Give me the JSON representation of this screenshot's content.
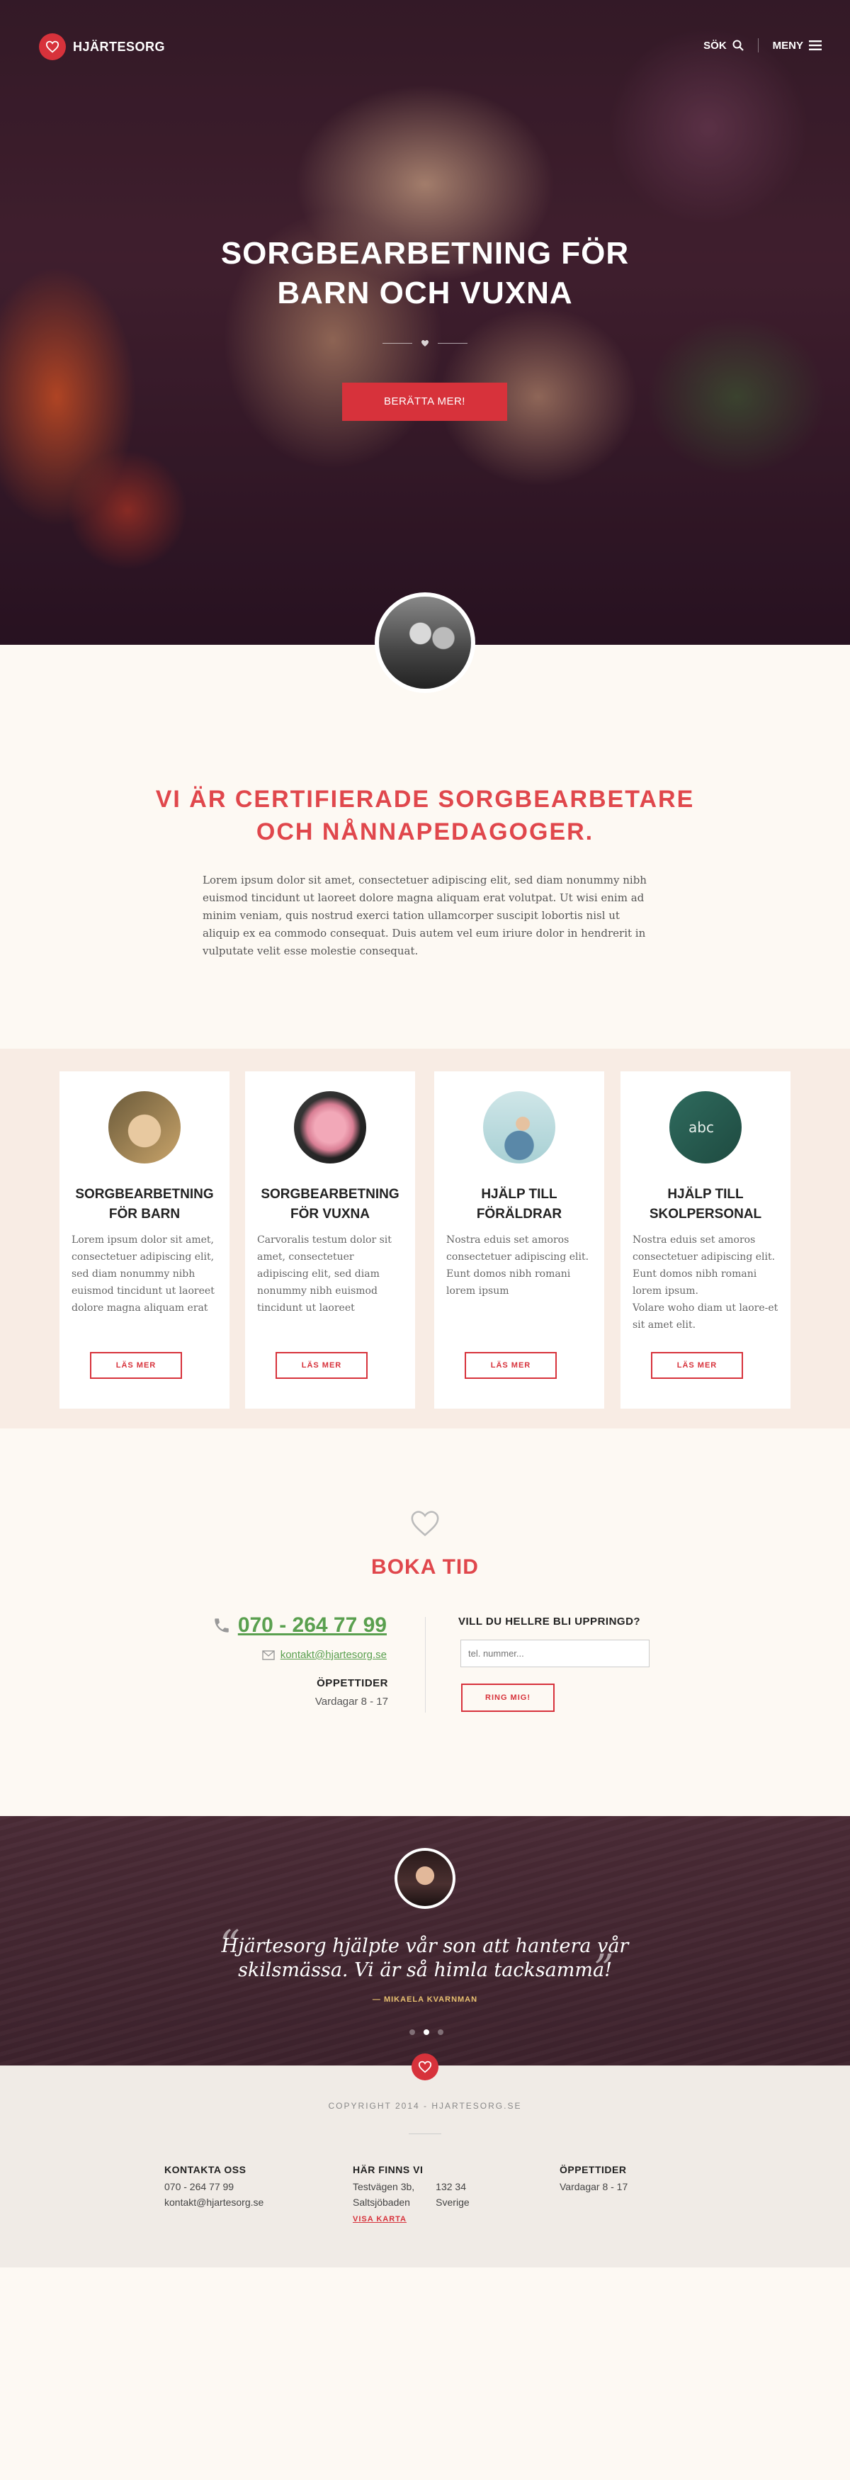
{
  "header": {
    "logo_text": "HJÄRTESORG",
    "search_label": "SÖK",
    "menu_label": "MENY"
  },
  "hero": {
    "title_line1": "SORGBEARBETNING FÖR",
    "title_line2": "BARN OCH VUXNA",
    "cta_label": "BERÄTTA MER!"
  },
  "intro": {
    "title_line1": "VI ÄR CERTIFIERADE SORGBEARBETARE",
    "title_line2": "OCH NÅNNAPEDAGOGER.",
    "text": "Lorem ipsum dolor sit amet, consectetuer adipiscing elit, sed diam nonummy nibh euismod tincidunt ut laoreet dolore magna aliquam erat volutpat. Ut wisi enim ad minim veniam, quis nostrud exerci tation ullamcorper suscipit lobortis nisl ut aliquip ex ea commodo consequat. Duis autem vel eum iriure dolor in hendrerit in vulputate velit esse molestie consequat."
  },
  "services": [
    {
      "title_line1": "SORGBEARBETNING",
      "title_line2": "FÖR BARN",
      "text": "Lorem ipsum dolor sit amet, consectetuer adipiscing elit, sed diam nonummy nibh euismod tincidunt ut laoreet dolore magna aliquam erat",
      "button": "LÄS MER"
    },
    {
      "title_line1": "SORGBEARBETNING",
      "title_line2": "FÖR VUXNA",
      "text": "Carvoralis testum dolor sit amet, consectetuer adipiscing elit, sed diam nonummy nibh euismod tincidunt ut laoreet",
      "button": "LÄS MER"
    },
    {
      "title_line1": "HJÄLP TILL",
      "title_line2": "FÖRÄLDRAR",
      "text": "Nostra eduis set amoros consectetuer adipiscing elit. Eunt domos nibh romani lorem ipsum",
      "button": "LÄS MER"
    },
    {
      "title_line1": "HJÄLP TILL",
      "title_line2": "SKOLPERSONAL",
      "text": "Nostra eduis set amoros consectetuer adipiscing elit. Eunt domos nibh romani lorem ipsum.\nVolare woho diam ut laore-et sit amet elit.",
      "button": "LÄS MER"
    }
  ],
  "booking": {
    "title": "BOKA TID",
    "phone": "070 - 264 77 99",
    "email": "kontakt@hjartesorg.se",
    "hours_heading": "ÖPPETTIDER",
    "hours_value": "Vardagar 8 - 17",
    "callback_heading": "VILL DU HELLRE BLI UPPRINGD?",
    "callback_placeholder": "tel. nummer...",
    "callback_button": "RING MIG!"
  },
  "testimonial": {
    "quote_line1": "Hjärtesorg hjälpte vår son att hantera vår",
    "quote_line2": "skilsmässa. Vi är så himla tacksamma!",
    "author": "— MIKAELA KVARNMAN",
    "slides": 3,
    "active_slide": 2
  },
  "footer": {
    "copyright": "COPYRIGHT 2014 - HJARTESORG.SE",
    "contact_heading": "KONTAKTA OSS",
    "contact_phone": "070 - 264 77 99",
    "contact_email": "kontakt@hjartesorg.se",
    "location_heading": "HÄR FINNS VI",
    "address_street": "Testvägen 3b,",
    "address_postcode": "132 34",
    "address_city": "Saltsjöbaden",
    "address_country": "Sverige",
    "map_link": "VISA KARTA",
    "hours_heading": "ÖPPETTIDER",
    "hours_value": "Vardagar 8 - 17"
  },
  "colors": {
    "accent": "#d7323b",
    "heading_red": "#e0474c",
    "link_green": "#5aa04f",
    "quote_author": "#e8c070"
  }
}
